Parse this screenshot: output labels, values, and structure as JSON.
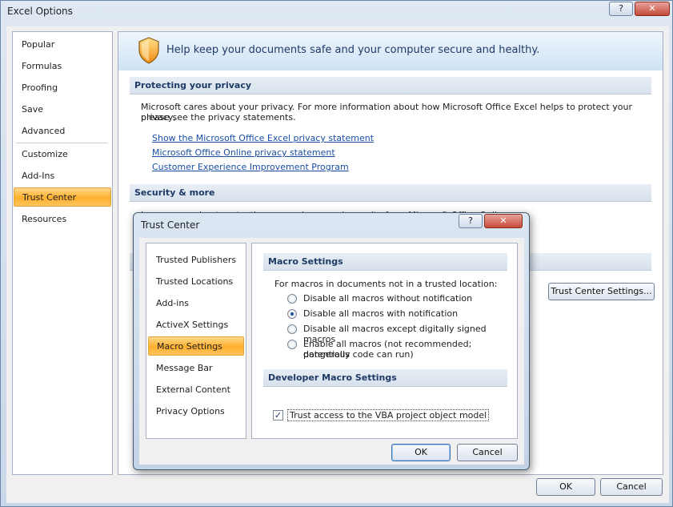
{
  "window": {
    "title": "Excel Options",
    "help_glyph": "?",
    "close_glyph": "✕"
  },
  "nav": {
    "items": [
      {
        "label": "Popular"
      },
      {
        "label": "Formulas"
      },
      {
        "label": "Proofing"
      },
      {
        "label": "Save"
      },
      {
        "label": "Advanced"
      },
      {
        "label": "Customize"
      },
      {
        "label": "Add-Ins"
      },
      {
        "label": "Trust Center",
        "selected": true
      },
      {
        "label": "Resources"
      }
    ]
  },
  "main": {
    "banner_text": "Help keep your documents safe and your computer secure and healthy.",
    "privacy": {
      "header": "Protecting your privacy",
      "description_line1": "Microsoft cares about your privacy. For more information about how Microsoft Office Excel helps to protect your privacy,",
      "description_line2": "please see the privacy statements.",
      "links": [
        "Show the Microsoft Office Excel privacy statement",
        "Microsoft Office Online privacy statement",
        "Customer Experience Improvement Program"
      ]
    },
    "security": {
      "header": "Security & more",
      "partial_text": "Learn more about protecting your privacy and security from Microsoft Office Online."
    },
    "trust_center_settings_button": "Trust Center Settings..."
  },
  "footer": {
    "ok_label": "OK",
    "cancel_label": "Cancel"
  },
  "dialog": {
    "title": "Trust Center",
    "help_glyph": "?",
    "close_glyph": "✕",
    "nav": [
      {
        "label": "Trusted Publishers"
      },
      {
        "label": "Trusted Locations"
      },
      {
        "label": "Add-ins"
      },
      {
        "label": "ActiveX Settings"
      },
      {
        "label": "Macro Settings",
        "selected": true
      },
      {
        "label": "Message Bar"
      },
      {
        "label": "External Content"
      },
      {
        "label": "Privacy Options"
      }
    ],
    "macro": {
      "header": "Macro Settings",
      "intro": "For macros in documents not in a trusted location:",
      "options": [
        {
          "label": "Disable all macros without notification",
          "checked": false
        },
        {
          "label": "Disable all macros with notification",
          "checked": true
        },
        {
          "label": "Disable all macros except digitally signed macros",
          "checked": false
        },
        {
          "label": "Enable all macros (not recommended; potentially",
          "label2": "dangerous code can run)",
          "checked": false
        }
      ]
    },
    "developer": {
      "header": "Developer Macro Settings",
      "vba_label": "Trust access to the VBA project object model",
      "vba_checked": true,
      "check_glyph": "✓"
    },
    "ok_label": "OK",
    "cancel_label": "Cancel"
  }
}
